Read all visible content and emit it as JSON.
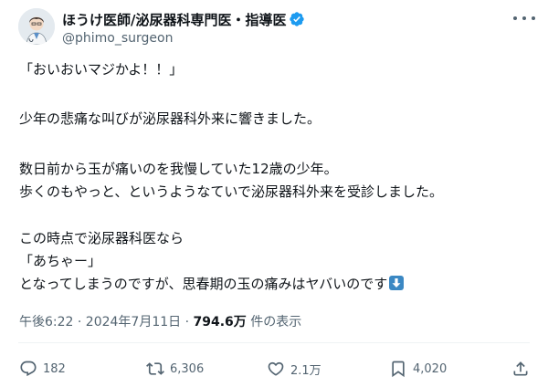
{
  "author": {
    "display_name": "ほうけ医師/泌尿器科専門医・指導医",
    "handle": "@phimo_surgeon",
    "verified_icon": "verified-badge-icon",
    "more_icon": "more-options-icon"
  },
  "tweet": {
    "lines": [
      "「おいおいマジかよ！！」",
      "少年の悲痛な叫びが泌尿器科外来に響きました。",
      "数日前から玉が痛いのを我慢していた12歳の少年。",
      "歩くのもやっと、というようなていで泌尿器科外来を受診しました。",
      "この時点で泌尿器科医なら",
      "「あちゃー」",
      "となってしまうのですが、思春期の玉の痛みはヤバいのです"
    ],
    "trailing_emoji": "down-arrow-emoji"
  },
  "meta": {
    "timestamp": "午後6:22 · 2024年7月11日 · ",
    "views_count": "794.6万",
    "views_label": " 件の表示"
  },
  "actions": {
    "replies": "182",
    "retweets": "6,306",
    "likes": "2.1万",
    "bookmarks": "4,020"
  },
  "colors": {
    "text_primary": "#0f1419",
    "text_secondary": "#536471",
    "verified_blue": "#1d9bf0",
    "emoji_blue": "#3b88c3",
    "divider": "#eff3f4"
  }
}
